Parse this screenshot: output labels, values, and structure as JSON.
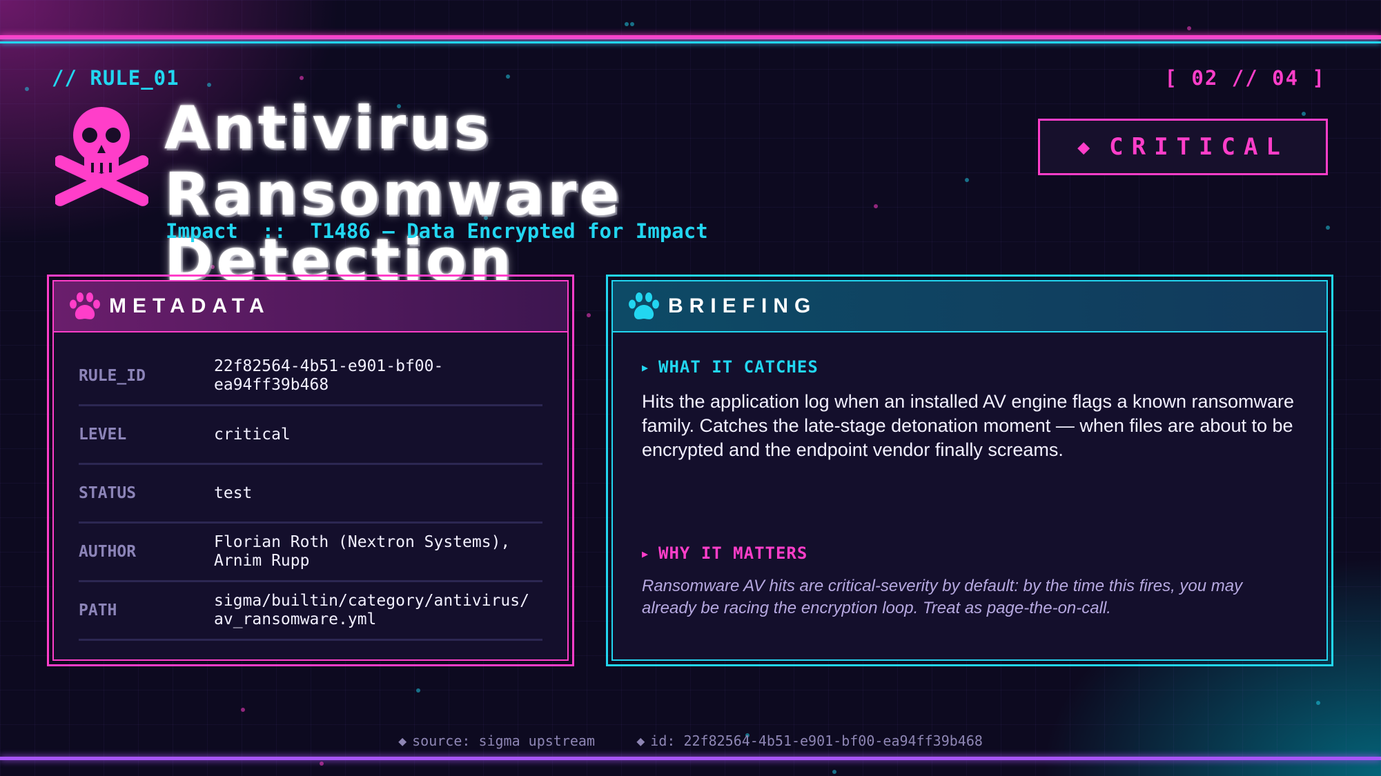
{
  "header": {
    "rule_tag": "// RULE_01",
    "counter": "[ 02 // 04 ]",
    "title": "Antivirus Ransomware Detection",
    "subtitle": "Impact  ::  T1486 — Data Encrypted for Impact",
    "severity_label": "CRITICAL",
    "severity_icon": "diamond-icon"
  },
  "metadata_panel": {
    "heading": "METADATA",
    "icon": "paw-icon",
    "rows": [
      {
        "key": "RULE_ID",
        "value": "22f82564-4b51-e901-bf00-\nea94ff39b468"
      },
      {
        "key": "LEVEL",
        "value": "critical"
      },
      {
        "key": "STATUS",
        "value": "test"
      },
      {
        "key": "AUTHOR",
        "value": "Florian Roth (Nextron Systems),\nArnim Rupp"
      },
      {
        "key": "PATH",
        "value": "sigma/builtin/category/antivirus/\nav_ransomware.yml"
      }
    ]
  },
  "briefing_panel": {
    "heading": "BRIEFING",
    "icon": "paw-icon",
    "catches_heading": "WHAT IT CATCHES",
    "catches_text": "Hits the application log when an installed AV engine flags a known ransomware family. Catches the late-stage detonation moment — when files are about to be encrypted and the endpoint vendor finally screams.",
    "matters_heading": "WHY IT MATTERS",
    "matters_text": "Ransomware AV hits are critical-severity by default: by the time this fires, you may already be racing the encryption loop. Treat as page-the-on-call."
  },
  "footer": {
    "source": "source: sigma upstream",
    "id": "id: 22f82564-4b51-e901-bf00-ea94ff39b468"
  },
  "colors": {
    "pink": "#ff3ec9",
    "cyan": "#22d6f0",
    "purple": "#a855f7",
    "background": "#0d0a20",
    "panel": "#140f2c"
  }
}
